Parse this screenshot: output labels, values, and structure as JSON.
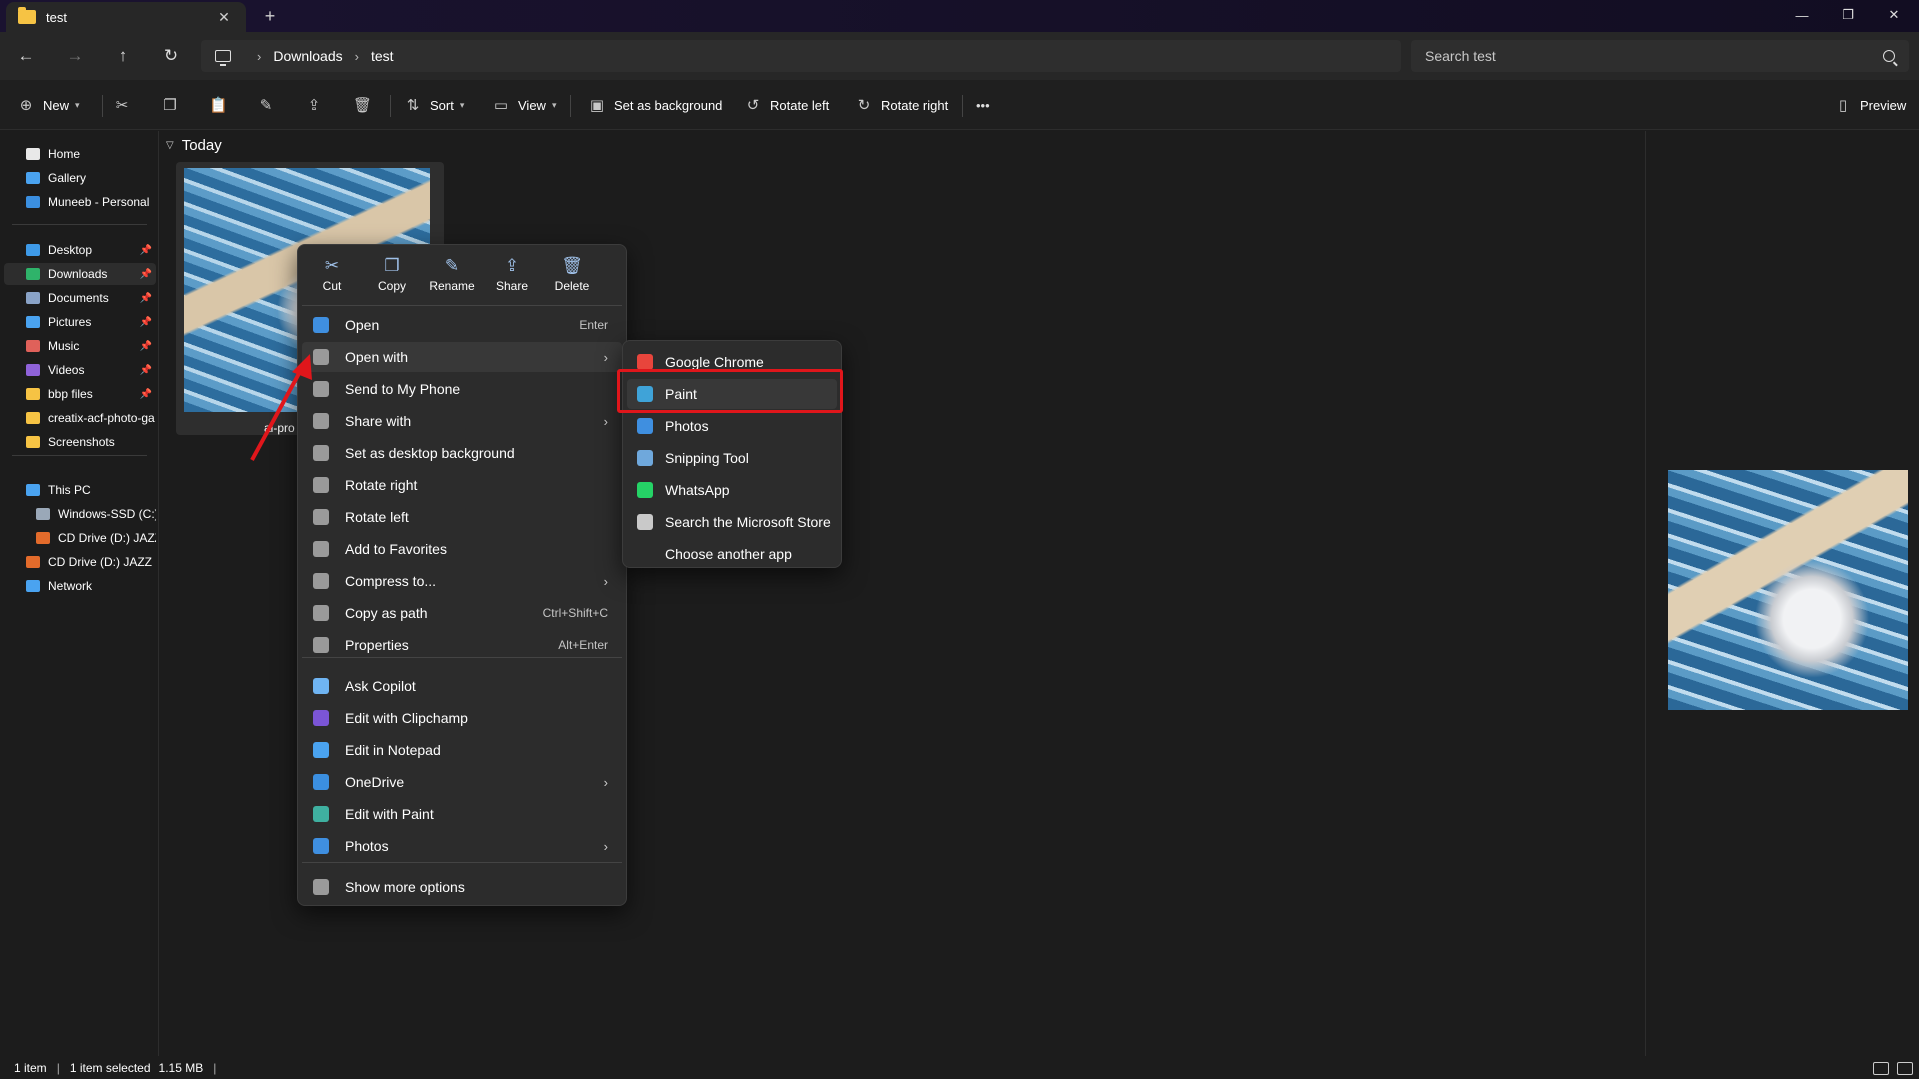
{
  "window": {
    "tab_title": "test",
    "tab_close": "✕",
    "new_tab": "+",
    "minimize": "—",
    "restore": "❐",
    "close": "✕"
  },
  "address": {
    "crumbs": [
      "Downloads",
      "test"
    ],
    "search_placeholder": "Search test"
  },
  "commandbar": {
    "new_label": "New",
    "sort_label": "Sort",
    "view_label": "View",
    "set_bg_label": "Set as background",
    "rotate_left_label": "Rotate left",
    "rotate_right_label": "Rotate right",
    "more_label": "•••",
    "preview_label": "Preview"
  },
  "sidebar": {
    "items": [
      {
        "label": "Home",
        "icon": "home-icon",
        "color": "#e8e8e8"
      },
      {
        "label": "Gallery",
        "icon": "gallery-icon",
        "color": "#4aa3f0"
      },
      {
        "label": "Muneeb - Personal",
        "icon": "onedrive-icon",
        "color": "#3b8fe0"
      },
      {
        "label": "Desktop",
        "icon": "desktop-icon",
        "color": "#3e9ae8",
        "pinned": true
      },
      {
        "label": "Downloads",
        "icon": "downloads-icon",
        "color": "#2fb36a",
        "pinned": true
      },
      {
        "label": "Documents",
        "icon": "documents-icon",
        "color": "#8aa3c7",
        "pinned": true
      },
      {
        "label": "Pictures",
        "icon": "pictures-icon",
        "color": "#4aa3f0",
        "pinned": true
      },
      {
        "label": "Music",
        "icon": "music-icon",
        "color": "#e0615a",
        "pinned": true
      },
      {
        "label": "Videos",
        "icon": "videos-icon",
        "color": "#8f62d9",
        "pinned": true
      },
      {
        "label": "bbp files",
        "icon": "folder-icon",
        "color": "#f6c344",
        "pinned": true
      },
      {
        "label": "creatix-acf-photo-ga",
        "icon": "folder-icon",
        "color": "#f6c344"
      },
      {
        "label": "Screenshots",
        "icon": "folder-icon",
        "color": "#f6c344"
      },
      {
        "label": "This PC",
        "icon": "this-pc-icon",
        "color": "#4aa3f0"
      },
      {
        "label": "Windows-SSD (C:)",
        "icon": "drive-icon",
        "color": "#9aa8b8"
      },
      {
        "label": "CD Drive (D:) JAZZ",
        "icon": "cd-drive-icon",
        "color": "#e36b2b"
      },
      {
        "label": "CD Drive (D:) JAZZ",
        "icon": "cd-drive-icon",
        "color": "#e36b2b"
      },
      {
        "label": "Network",
        "icon": "network-icon",
        "color": "#4aa3f0"
      }
    ],
    "pin_glyph": "📌"
  },
  "content": {
    "group_label": "Today",
    "file_name_fragment": "ai-pro"
  },
  "context_menu": {
    "quick_actions": [
      {
        "label": "Cut",
        "icon": "cut-icon",
        "glyph": "✂"
      },
      {
        "label": "Copy",
        "icon": "copy-icon",
        "glyph": "❐"
      },
      {
        "label": "Rename",
        "icon": "rename-icon",
        "glyph": "✎"
      },
      {
        "label": "Share",
        "icon": "share-icon",
        "glyph": "⇪"
      },
      {
        "label": "Delete",
        "icon": "delete-icon",
        "glyph": "🗑"
      }
    ],
    "items": [
      {
        "label": "Open",
        "shortcut": "Enter",
        "icon": "open-icon",
        "color": "#3f8fe0"
      },
      {
        "label": "Open with",
        "icon": "open-with-icon",
        "color": "#9a9a9a",
        "submenu": true
      },
      {
        "label": "Send to My Phone",
        "icon": "phone-icon",
        "color": "#9a9a9a"
      },
      {
        "label": "Share with",
        "icon": "share-with-icon",
        "color": "#9a9a9a",
        "submenu": true
      },
      {
        "label": "Set as desktop background",
        "icon": "background-icon",
        "color": "#9a9a9a"
      },
      {
        "label": "Rotate right",
        "icon": "rotate-right-icon",
        "color": "#9a9a9a"
      },
      {
        "label": "Rotate left",
        "icon": "rotate-left-icon",
        "color": "#9a9a9a"
      },
      {
        "label": "Add to Favorites",
        "icon": "star-icon",
        "color": "#9a9a9a"
      },
      {
        "label": "Compress to...",
        "icon": "compress-icon",
        "color": "#9a9a9a",
        "submenu": true
      },
      {
        "label": "Copy as path",
        "shortcut": "Ctrl+Shift+C",
        "icon": "copy-path-icon",
        "color": "#9a9a9a"
      },
      {
        "label": "Properties",
        "shortcut": "Alt+Enter",
        "icon": "wrench-icon",
        "color": "#9a9a9a"
      },
      {
        "label": "Ask Copilot",
        "icon": "copilot-icon",
        "color": "#6fb4f2"
      },
      {
        "label": "Edit with Clipchamp",
        "icon": "clipchamp-icon",
        "color": "#7b55d6"
      },
      {
        "label": "Edit in Notepad",
        "icon": "notepad-icon",
        "color": "#4aa3f0"
      },
      {
        "label": "OneDrive",
        "icon": "onedrive-icon",
        "color": "#3b8fe0",
        "submenu": true
      },
      {
        "label": "Edit with Paint",
        "icon": "paint-icon",
        "color": "#3fb0a0"
      },
      {
        "label": "Photos",
        "icon": "photos-icon",
        "color": "#3f8fe0",
        "submenu": true
      },
      {
        "label": "Show more options",
        "icon": "more-options-icon",
        "color": "#9a9a9a"
      }
    ],
    "submenu_arrow": "›"
  },
  "open_with": {
    "items": [
      {
        "label": "Google Chrome",
        "icon": "chrome-icon",
        "color": "#e8453c"
      },
      {
        "label": "Paint",
        "icon": "paint-icon",
        "color": "#3fa3d8"
      },
      {
        "label": "Photos",
        "icon": "photos-icon",
        "color": "#3f8fe0"
      },
      {
        "label": "Snipping Tool",
        "icon": "snipping-tool-icon",
        "color": "#6fa8dc"
      },
      {
        "label": "WhatsApp",
        "icon": "whatsapp-icon",
        "color": "#25d366"
      },
      {
        "label": "Search the Microsoft Store",
        "icon": "store-icon",
        "color": "#c9c9c9"
      },
      {
        "label": "Choose another app",
        "icon": "",
        "color": ""
      }
    ],
    "highlight_color": "#e0161b"
  },
  "status": {
    "items_count": "1 item",
    "selected": "1 item selected",
    "size": "1.15 MB"
  }
}
